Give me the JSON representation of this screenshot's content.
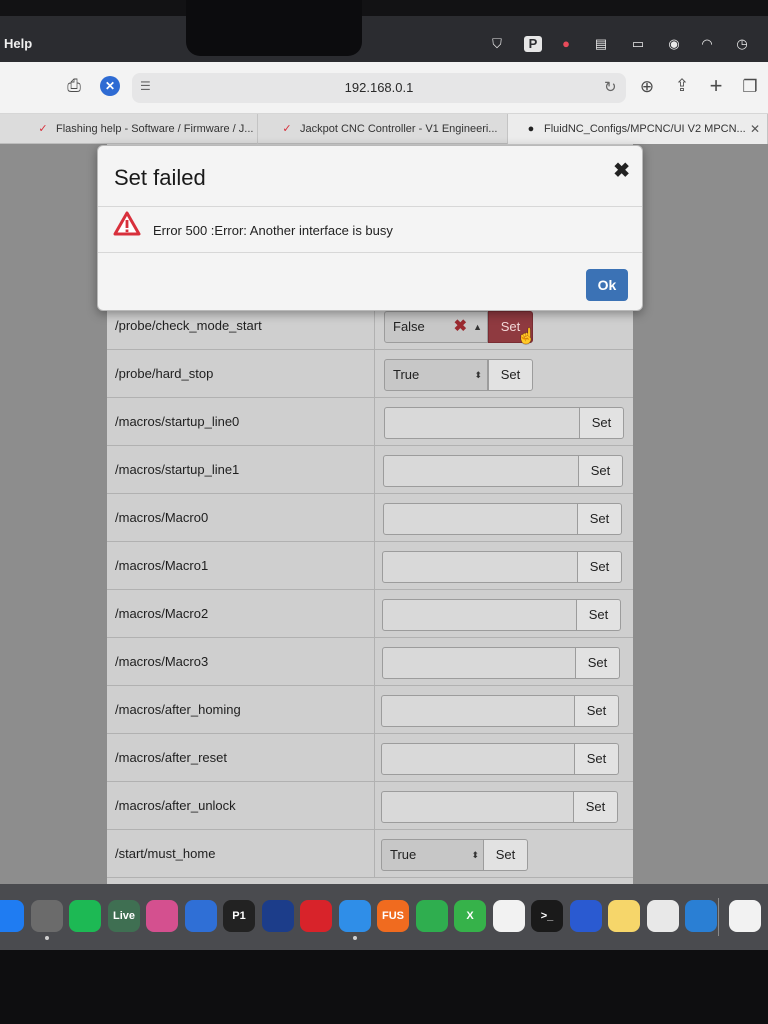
{
  "menubar": {
    "menu": "Help",
    "status_icons": [
      "shield-lock-icon",
      "p-badge-icon",
      "cleanmaster-icon",
      "display-icon",
      "battery-charging-icon",
      "user-icon",
      "wifi-icon",
      "time-machine-icon"
    ]
  },
  "toolbar": {
    "url": "192.168.0.1",
    "buttons": [
      "print-icon",
      "stop-icon",
      "download-icon",
      "share-icon",
      "new-tab-icon",
      "tab-overview-icon"
    ]
  },
  "tabs": [
    {
      "label": "Flashing help - Software / Firmware / J...",
      "icon": "v1-logo-icon"
    },
    {
      "label": "Jackpot CNC Controller - V1 Engineeri...",
      "icon": "v1-logo-icon"
    },
    {
      "label": "FluidNC_Configs/MPCNC/UI V2 MPCN...",
      "icon": "github-icon"
    }
  ],
  "settings": [
    {
      "key": "/probe/check_mode_start",
      "type": "select",
      "value": "False",
      "button": "Set"
    },
    {
      "key": "/probe/hard_stop",
      "type": "select",
      "value": "True",
      "button": "Set"
    },
    {
      "key": "/macros/startup_line0",
      "type": "text",
      "value": "",
      "button": "Set"
    },
    {
      "key": "/macros/startup_line1",
      "type": "text",
      "value": "",
      "button": "Set"
    },
    {
      "key": "/macros/Macro0",
      "type": "text",
      "value": "",
      "button": "Set"
    },
    {
      "key": "/macros/Macro1",
      "type": "text",
      "value": "",
      "button": "Set"
    },
    {
      "key": "/macros/Macro2",
      "type": "text",
      "value": "",
      "button": "Set"
    },
    {
      "key": "/macros/Macro3",
      "type": "text",
      "value": "",
      "button": "Set"
    },
    {
      "key": "/macros/after_homing",
      "type": "text",
      "value": "",
      "button": "Set"
    },
    {
      "key": "/macros/after_reset",
      "type": "text",
      "value": "",
      "button": "Set"
    },
    {
      "key": "/macros/after_unlock",
      "type": "text",
      "value": "",
      "button": "Set"
    },
    {
      "key": "/start/must_home",
      "type": "select",
      "value": "True",
      "button": "Set"
    }
  ],
  "modal": {
    "title": "Set failed",
    "message": "Error 500 :Error: Another interface is busy",
    "ok_label": "Ok"
  },
  "dock": {
    "apps": [
      {
        "name": "app-store-icon",
        "label": "",
        "color": "#1f7cf2"
      },
      {
        "name": "system-settings-icon",
        "label": "",
        "color": "#6b6b6b"
      },
      {
        "name": "spotify-icon",
        "label": "",
        "color": "#1db954"
      },
      {
        "name": "ableton-live-icon",
        "label": "Live",
        "color": "#3f6f52"
      },
      {
        "name": "colorsync-icon",
        "label": "",
        "color": "#d4508f"
      },
      {
        "name": "wave-app-icon",
        "label": "",
        "color": "#2f6fd6"
      },
      {
        "name": "p1-icon",
        "label": "P1",
        "color": "#222222"
      },
      {
        "name": "tiles-app-icon",
        "label": "",
        "color": "#1c3d8a"
      },
      {
        "name": "acrobat-icon",
        "label": "",
        "color": "#d8232a"
      },
      {
        "name": "safari-icon",
        "label": "",
        "color": "#2f8ee8"
      },
      {
        "name": "fusion-icon",
        "label": "FUS",
        "color": "#f06b1f"
      },
      {
        "name": "numbers-icon",
        "label": "",
        "color": "#2fae4f"
      },
      {
        "name": "xtool-icon",
        "label": "X",
        "color": "#36b24a"
      },
      {
        "name": "kiri-icon",
        "label": "",
        "color": "#f2f2f2"
      },
      {
        "name": "terminal-icon",
        "label": ">_",
        "color": "#1a1a1a"
      },
      {
        "name": "box-app-icon",
        "label": "",
        "color": "#2a5ad1"
      },
      {
        "name": "notes-icon",
        "label": "",
        "color": "#f6d66a"
      },
      {
        "name": "cura-icon",
        "label": "",
        "color": "#e8e8e8"
      },
      {
        "name": "vscode-icon",
        "label": "",
        "color": "#2a7fd4"
      },
      {
        "name": "chrome-icon",
        "label": "",
        "color": "#f2f2f2"
      }
    ]
  },
  "colors": {
    "accent": "#3b72b5",
    "danger": "#8f3a40",
    "warning": "#d8303c"
  }
}
